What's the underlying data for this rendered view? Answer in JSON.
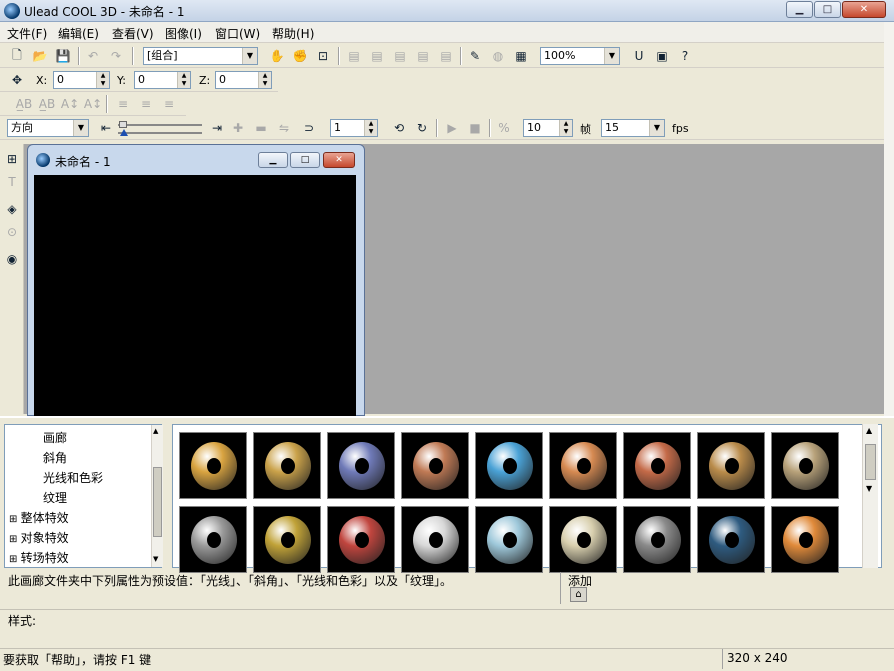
{
  "app": {
    "title": "Ulead COOL 3D - 未命名 - 1"
  },
  "menu": [
    "文件(F)",
    "编辑(E)",
    "查看(V)",
    "图像(I)",
    "窗口(W)",
    "帮助(H)"
  ],
  "toolbar": {
    "object_select": "[组合]",
    "zoom": "100%"
  },
  "position": {
    "x_label": "X:",
    "x_value": "0",
    "y_label": "Y:",
    "y_value": "0",
    "z_label": "Z:",
    "z_value": "0"
  },
  "animation": {
    "property_select": "方向",
    "frame_value": "1",
    "frames_total": "10",
    "frames_label": "帧",
    "fps_value": "15",
    "fps_label": "fps"
  },
  "document": {
    "title": "未命名 - 1"
  },
  "tree": [
    {
      "label": "画廊",
      "indent": "leaf"
    },
    {
      "label": "斜角",
      "indent": "leaf"
    },
    {
      "label": "光线和色彩",
      "indent": "leaf"
    },
    {
      "label": "纹理",
      "indent": "leaf"
    },
    {
      "label": "整体特效",
      "indent": "group"
    },
    {
      "label": "对象特效",
      "indent": "group"
    },
    {
      "label": "转场特效",
      "indent": "group"
    }
  ],
  "thumb_colors": [
    "#d9a441",
    "#caa24a",
    "#6f7ab8",
    "#c07a55",
    "#4aa2d6",
    "#d68a52",
    "#c46a48",
    "#b98b4a",
    "#b8a27a",
    "#9a9a9a",
    "#c0a238",
    "#c0453e",
    "#d8d8d8",
    "#9ec8da",
    "#d8cfae",
    "#8a8a8a",
    "#2e5b80",
    "#e08a3a"
  ],
  "description": "此画廊文件夹中下列属性为预设值：「光线」、「斜角」、「光线和色彩」以及「纹理」。",
  "add_label": "添加",
  "style_label": "样式:",
  "status": {
    "help_text": "要获取「帮助」，请按 F1 键",
    "canvas_size": "320 x 240"
  }
}
